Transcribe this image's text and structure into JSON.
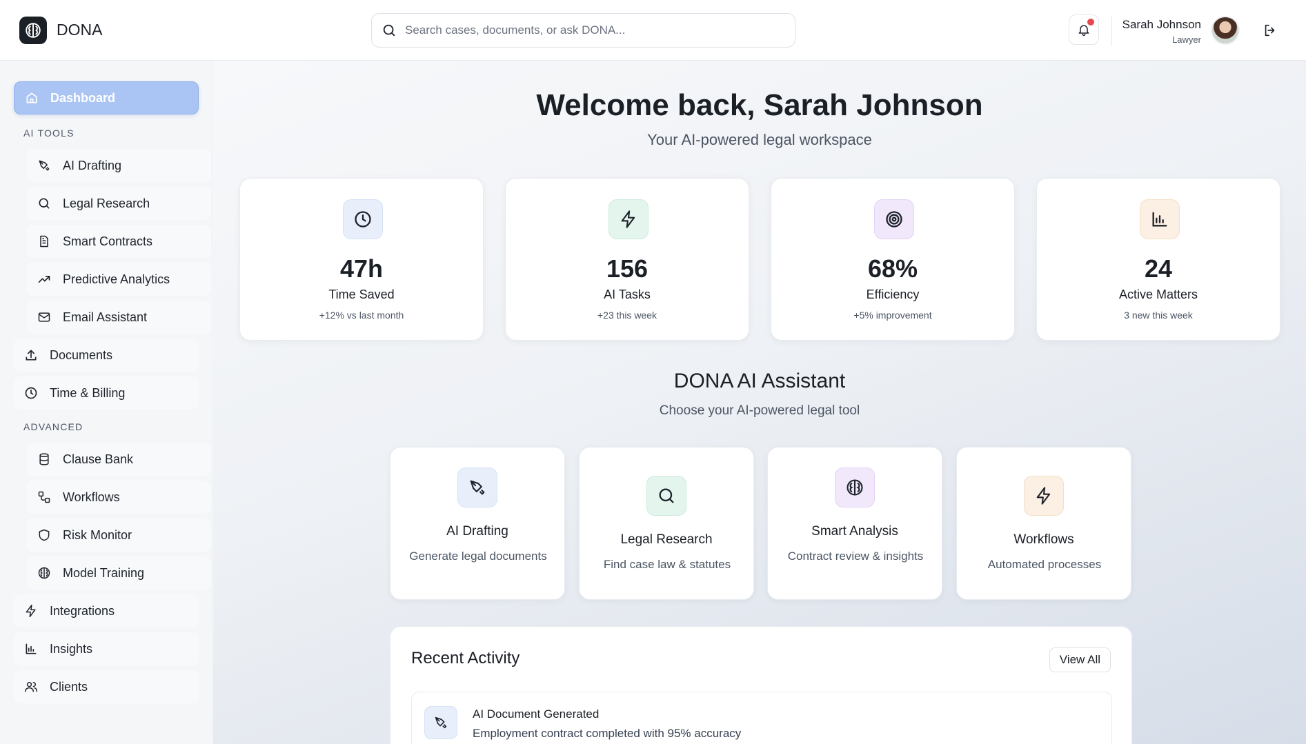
{
  "header": {
    "brand": "DONA",
    "search_placeholder": "Search cases, documents, or ask DONA...",
    "user_name": "Sarah Johnson",
    "user_role": "Lawyer"
  },
  "sidebar": {
    "dashboard": "Dashboard",
    "ai_tools_label": "AI TOOLS",
    "ai_tools": [
      "AI Drafting",
      "Legal Research",
      "Smart Contracts",
      "Predictive Analytics",
      "Email Assistant"
    ],
    "documents": "Documents",
    "time_billing": "Time & Billing",
    "advanced_label": "ADVANCED",
    "advanced": [
      "Clause Bank",
      "Workflows",
      "Risk Monitor",
      "Model Training"
    ],
    "integrations": "Integrations",
    "insights": "Insights",
    "clients": "Clients"
  },
  "main": {
    "welcome": "Welcome back, Sarah Johnson",
    "welcome_sub": "Your AI-powered legal workspace",
    "stats": [
      {
        "value": "47h",
        "label": "Time Saved",
        "sub": "+12% vs last month"
      },
      {
        "value": "156",
        "label": "AI Tasks",
        "sub": "+23 this week"
      },
      {
        "value": "68%",
        "label": "Efficiency",
        "sub": "+5% improvement"
      },
      {
        "value": "24",
        "label": "Active Matters",
        "sub": "3 new this week"
      }
    ],
    "assistant_title": "DONA AI Assistant",
    "assistant_sub": "Choose your AI-powered legal tool",
    "tools": [
      {
        "title": "AI Drafting",
        "desc": "Generate legal documents"
      },
      {
        "title": "Legal Research",
        "desc": "Find case law & statutes"
      },
      {
        "title": "Smart Analysis",
        "desc": "Contract review & insights"
      },
      {
        "title": "Workflows",
        "desc": "Automated processes"
      }
    ],
    "activity": {
      "title": "Recent Activity",
      "view_all": "View All",
      "items": [
        {
          "title": "AI Document Generated",
          "desc": "Employment contract completed with 95% accuracy"
        }
      ]
    }
  },
  "colors": {
    "accent": "#aac5f4",
    "dark": "#1b1f26",
    "notification": "#e5484d"
  },
  "icons": [
    "brain-icon",
    "search-icon",
    "bell-icon",
    "logout-icon",
    "home-icon",
    "pen-tool-icon",
    "file-text-icon",
    "trending-up-icon",
    "mail-icon",
    "upload-icon",
    "clock-icon",
    "database-icon",
    "workflow-icon",
    "shield-icon",
    "zap-icon",
    "bar-chart-icon",
    "users-icon",
    "target-icon"
  ]
}
